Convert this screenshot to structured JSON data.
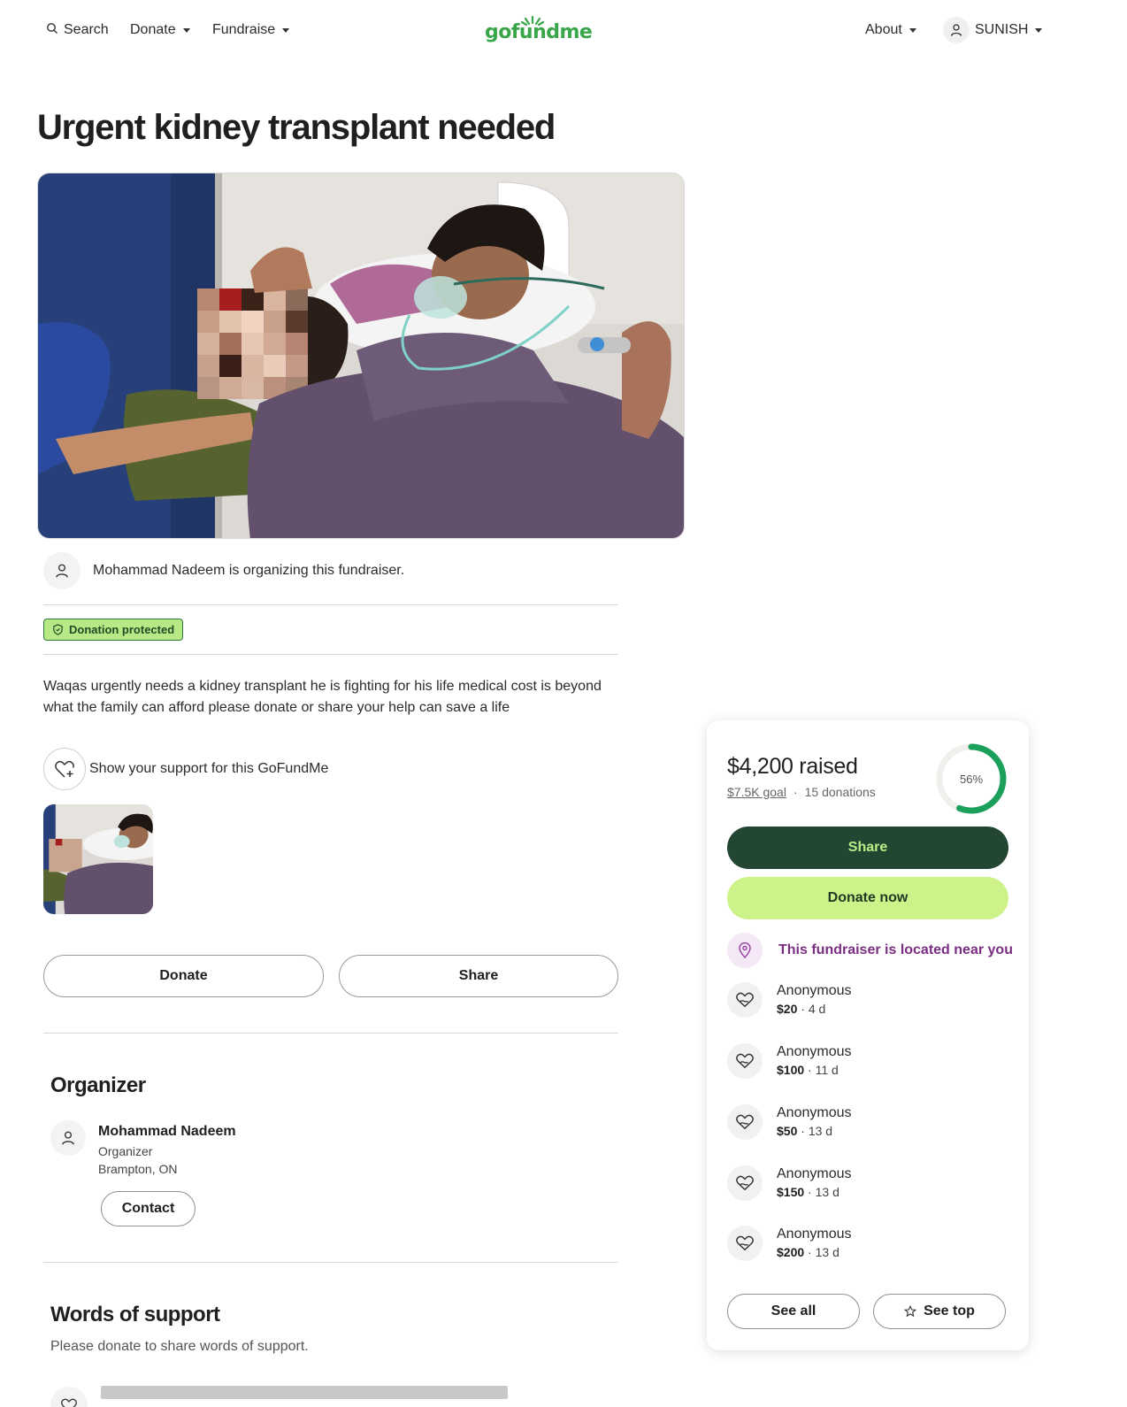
{
  "header": {
    "search_label": "Search",
    "donate_label": "Donate",
    "fundraise_label": "Fundraise",
    "logo_text": "gofundme",
    "about_label": "About",
    "user_name": "SUNISH",
    "brand_color": "#3aa64a"
  },
  "campaign": {
    "title": "Urgent kidney transplant needed",
    "organizer_line": "Mohammad Nadeem is organizing this fundraiser.",
    "badge_label": "Donation protected",
    "story": "Waqas urgently needs a kidney transplant he is fighting for his life medical cost is beyond what the family can afford please donate or share your help can save a life",
    "support_label": "Show your support for this GoFundMe",
    "donate_button": "Donate",
    "share_button": "Share"
  },
  "organizer_section": {
    "heading": "Organizer",
    "name": "Mohammad Nadeem",
    "role": "Organizer",
    "location": "Brampton, ON",
    "contact_button": "Contact"
  },
  "words_of_support": {
    "heading": "Words of support",
    "subtitle": "Please donate to share words of support."
  },
  "donation_card": {
    "raised": "$4,200 raised",
    "goal": "$7.5K goal",
    "separator": "·",
    "donations": "15 donations",
    "progress_label": "56%",
    "progress_fraction": 0.56,
    "share_button": "Share",
    "donate_button": "Donate now",
    "location_notice": "This fundraiser is located near you",
    "donors": [
      {
        "name": "Anonymous",
        "amount": "$20",
        "age": "4 d"
      },
      {
        "name": "Anonymous",
        "amount": "$100",
        "age": "11 d"
      },
      {
        "name": "Anonymous",
        "amount": "$50",
        "age": "13 d"
      },
      {
        "name": "Anonymous",
        "amount": "$150",
        "age": "13 d"
      },
      {
        "name": "Anonymous",
        "amount": "$200",
        "age": "13 d"
      }
    ],
    "see_all_button": "See all",
    "see_top_button": "See top",
    "share_color": "#224632",
    "donate_color": "#cdf28a",
    "ring_color": "#1aa05a"
  }
}
